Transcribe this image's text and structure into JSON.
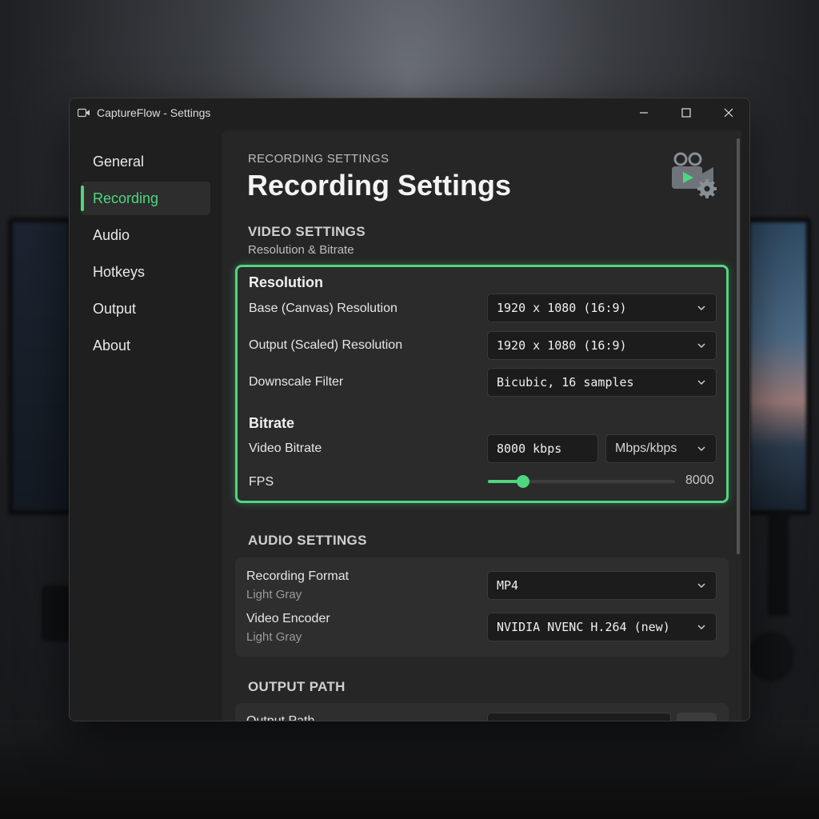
{
  "window": {
    "title": "CaptureFlow - Settings"
  },
  "sidebar": {
    "items": [
      {
        "label": "General",
        "active": false
      },
      {
        "label": "Recording",
        "active": true
      },
      {
        "label": "Audio",
        "active": false
      },
      {
        "label": "Hotkeys",
        "active": false
      },
      {
        "label": "Output",
        "active": false
      },
      {
        "label": "About",
        "active": false
      }
    ]
  },
  "header": {
    "breadcrumb": "RECORDING SETTINGS",
    "title": "Recording Settings"
  },
  "video_settings": {
    "heading": "VIDEO SETTINGS",
    "subheading": "Resolution & Bitrate",
    "resolution": {
      "title": "Resolution",
      "base_label": "Base (Canvas) Resolution",
      "base_value": "1920 x 1080 (16:9)",
      "output_label": "Output (Scaled) Resolution",
      "output_value": "1920 x 1080 (16:9)",
      "filter_label": "Downscale Filter",
      "filter_value": "Bicubic, 16 samples"
    },
    "bitrate": {
      "title": "Bitrate",
      "video_bitrate_label": "Video Bitrate",
      "video_bitrate_value": "8000 kbps",
      "unit_value": "Mbps/kbps",
      "fps_label": "FPS",
      "fps_value_text": "8000",
      "fps_slider_fraction": 0.19
    }
  },
  "audio_settings": {
    "heading": "AUDIO SETTINGS",
    "recording_format_label": "Recording Format",
    "recording_format_sub": "Light Gray",
    "recording_format_value": "MP4",
    "video_encoder_label": "Video Encoder",
    "video_encoder_sub": "Light Gray",
    "video_encoder_value": "NVIDIA NVENC H.264 (new)"
  },
  "output_path": {
    "heading": "OUTPUT PATH",
    "label": "Output Path"
  },
  "colors": {
    "accent": "#4fd67f",
    "window_bg": "#1f1f1f",
    "content_bg": "#262626"
  },
  "icons": [
    "app-camera-icon",
    "minimize-icon",
    "maximize-icon",
    "close-icon",
    "camera-settings-icon",
    "chevron-down-icon"
  ]
}
